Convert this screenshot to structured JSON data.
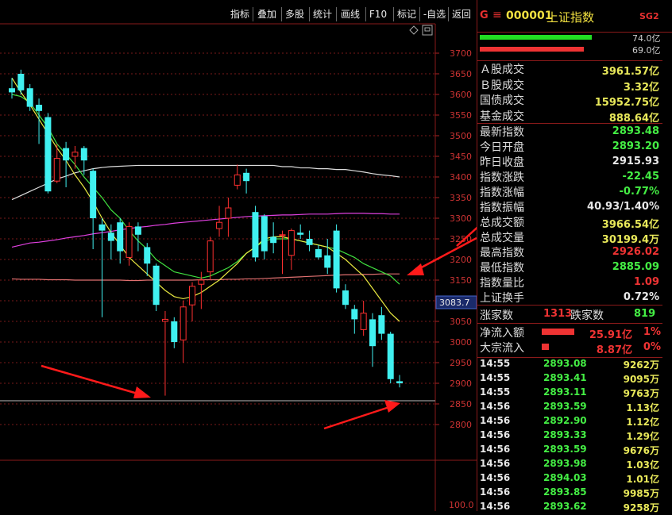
{
  "toolbar": {
    "buttons": [
      "指标",
      "叠加",
      "多股",
      "统计",
      "画线",
      "F10",
      "标记",
      "-自选",
      "返回"
    ]
  },
  "header": {
    "g": "G",
    "menu_glyph": "≡",
    "code": "000001",
    "name": "上证指数",
    "badge": "SG2"
  },
  "bars": [
    {
      "color": "#22dd22",
      "fill": 0.74,
      "label": "74.0亿"
    },
    {
      "color": "#ee3333",
      "fill": 0.69,
      "label": "69.0亿"
    }
  ],
  "turnover": [
    {
      "label": "Ａ股成交",
      "value": "3961.57亿",
      "color": "#e8e85a"
    },
    {
      "label": "Ｂ股成交",
      "value": "3.32亿",
      "color": "#e8e85a"
    },
    {
      "label": "国债成交",
      "value": "15952.75亿",
      "color": "#e8e85a"
    },
    {
      "label": "基金成交",
      "value": "888.64亿",
      "color": "#e8e85a"
    }
  ],
  "stats": [
    {
      "label": "最新指数",
      "value": "2893.48",
      "color": "#44ee44"
    },
    {
      "label": "今日开盘",
      "value": "2893.20",
      "color": "#44ee44"
    },
    {
      "label": "昨日收盘",
      "value": "2915.93",
      "color": "#e8e8e8"
    },
    {
      "label": "指数涨跌",
      "value": "-22.45",
      "color": "#44ee44"
    },
    {
      "label": "指数涨幅",
      "value": "-0.77%",
      "color": "#44ee44"
    },
    {
      "label": "指数振幅",
      "value": "40.93/1.40%",
      "color": "#e8e8e8"
    },
    {
      "label": "总成交额",
      "value": "3966.54亿",
      "color": "#e8e85a"
    },
    {
      "label": "总成交量",
      "value": "30199.4万",
      "color": "#e8e85a"
    },
    {
      "label": "最高指数",
      "value": "2926.02",
      "color": "#ee3333"
    },
    {
      "label": "最低指数",
      "value": "2885.09",
      "color": "#44ee44"
    },
    {
      "label": "指数量比",
      "value": "1.09",
      "color": "#ee3333"
    },
    {
      "label": "上证换手",
      "value": "0.72%",
      "color": "#e8e8e8"
    }
  ],
  "breadth": {
    "up_label": "涨家数",
    "up_value": "1313",
    "down_label": "跌家数",
    "down_value": "819"
  },
  "flows": [
    {
      "label": "净流入额",
      "value": "25.91亿",
      "pct": "1%",
      "bar": 0.9
    },
    {
      "label": "大宗流入",
      "value": "8.87亿",
      "pct": "0%",
      "bar": 0.2
    }
  ],
  "ticks": [
    {
      "time": "14:55",
      "price": "2893.08",
      "vol": "9262万"
    },
    {
      "time": "14:55",
      "price": "2893.41",
      "vol": "9095万"
    },
    {
      "time": "14:55",
      "price": "2893.11",
      "vol": "9763万"
    },
    {
      "time": "14:56",
      "price": "2893.59",
      "vol": "1.13亿"
    },
    {
      "time": "14:56",
      "price": "2892.90",
      "vol": "1.12亿"
    },
    {
      "time": "14:56",
      "price": "2893.33",
      "vol": "1.29亿"
    },
    {
      "time": "14:56",
      "price": "2893.59",
      "vol": "9676万"
    },
    {
      "time": "14:56",
      "price": "2893.98",
      "vol": "1.03亿"
    },
    {
      "time": "14:56",
      "price": "2894.03",
      "vol": "1.01亿"
    },
    {
      "time": "14:56",
      "price": "2893.85",
      "vol": "9985万"
    },
    {
      "time": "14:56",
      "price": "2893.62",
      "vol": "9258万"
    }
  ],
  "chart_data": {
    "type": "candlestick",
    "ylim": [
      2810,
      3730
    ],
    "yticks": [
      2800,
      2850,
      2900,
      2950,
      3000,
      3050,
      3100,
      3150,
      3200,
      3250,
      3300,
      3350,
      3400,
      3450,
      3500,
      3550,
      3600,
      3650,
      3700
    ],
    "current_price_label": "3083.7",
    "current_price": 3083.7,
    "lower_panel_label": "100.0",
    "support_level": 2870,
    "candles": [
      [
        3615,
        3605,
        3640,
        3590
      ],
      [
        3650,
        3610,
        3660,
        3600
      ],
      [
        3615,
        3570,
        3625,
        3560
      ],
      [
        3575,
        3560,
        3590,
        3480
      ],
      [
        3545,
        3365,
        3555,
        3360
      ],
      [
        3390,
        3445,
        3480,
        3385
      ],
      [
        3470,
        3440,
        3485,
        3375
      ],
      [
        3450,
        3460,
        3475,
        3420
      ],
      [
        3470,
        3440,
        3475,
        3405
      ],
      [
        3415,
        3300,
        3420,
        3225
      ],
      [
        3285,
        3270,
        3300,
        3060
      ],
      [
        3265,
        3245,
        3285,
        3200
      ],
      [
        3290,
        3220,
        3300,
        3190
      ],
      [
        3205,
        3280,
        3290,
        3185
      ],
      [
        3280,
        3260,
        3290,
        3220
      ],
      [
        3230,
        3190,
        3240,
        3160
      ],
      [
        3185,
        3090,
        3190,
        3075
      ],
      [
        3050,
        3055,
        3075,
        2870
      ],
      [
        3050,
        3000,
        3060,
        2985
      ],
      [
        3005,
        3085,
        3100,
        2950
      ],
      [
        3090,
        3135,
        3145,
        3050
      ],
      [
        3140,
        3150,
        3170,
        3080
      ],
      [
        3170,
        3245,
        3255,
        3150
      ],
      [
        3275,
        3290,
        3330,
        3255
      ],
      [
        3300,
        3325,
        3350,
        3255
      ],
      [
        3380,
        3405,
        3430,
        3370
      ],
      [
        3410,
        3390,
        3420,
        3360
      ],
      [
        3315,
        3205,
        3330,
        3195
      ],
      [
        3305,
        3220,
        3310,
        3200
      ],
      [
        3255,
        3240,
        3290,
        3215
      ],
      [
        3260,
        3260,
        3270,
        3165
      ],
      [
        3210,
        3270,
        3275,
        3175
      ],
      [
        3265,
        3260,
        3285,
        3250
      ],
      [
        3250,
        3235,
        3270,
        3220
      ],
      [
        3225,
        3205,
        3235,
        3200
      ],
      [
        3210,
        3180,
        3250,
        3165
      ],
      [
        3270,
        3130,
        3285,
        3120
      ],
      [
        3125,
        3090,
        3140,
        3080
      ],
      [
        3080,
        3055,
        3090,
        3020
      ],
      [
        3030,
        3070,
        3100,
        3015
      ],
      [
        3055,
        2990,
        3070,
        2940
      ],
      [
        3065,
        3020,
        3085,
        3005
      ],
      [
        3020,
        2910,
        3025,
        2900
      ],
      [
        2905,
        2900,
        2920,
        2890
      ]
    ],
    "ma_yellow": [
      3640,
      3605,
      3575,
      3540,
      3505,
      3470,
      3440,
      3405,
      3375,
      3340,
      3300,
      3265,
      3235,
      3205,
      3185,
      3165,
      3145,
      3125,
      3110,
      3105,
      3110,
      3120,
      3135,
      3150,
      3170,
      3190,
      3215,
      3230,
      3250,
      3255,
      3255,
      3250,
      3245,
      3240,
      3235,
      3230,
      3215,
      3200,
      3180,
      3160,
      3130,
      3100,
      3070,
      3050
    ],
    "ma_green": [
      3600,
      3595,
      3580,
      3550,
      3520,
      3480,
      3455,
      3430,
      3400,
      3375,
      3350,
      3320,
      3300,
      3270,
      3245,
      3225,
      3200,
      3185,
      3170,
      3165,
      3160,
      3155,
      3160,
      3170,
      3180,
      3195,
      3215,
      3230,
      3245,
      3250,
      3250,
      3250,
      3245,
      3240,
      3235,
      3230,
      3225,
      3215,
      3205,
      3190,
      3180,
      3170,
      3160,
      3140
    ],
    "ma_white": [
      3345,
      3355,
      3365,
      3375,
      3385,
      3395,
      3402,
      3410,
      3415,
      3420,
      3423,
      3425,
      3426,
      3427,
      3428,
      3428,
      3428,
      3428,
      3428,
      3428,
      3428,
      3428,
      3428,
      3428,
      3428,
      3428,
      3428,
      3428,
      3428,
      3428,
      3425,
      3425,
      3422,
      3422,
      3420,
      3420,
      3418,
      3418,
      3415,
      3412,
      3408,
      3405,
      3403,
      3400
    ],
    "ma_magenta": [
      3230,
      3235,
      3240,
      3242,
      3245,
      3248,
      3252,
      3255,
      3258,
      3262,
      3265,
      3268,
      3272,
      3275,
      3278,
      3280,
      3283,
      3285,
      3288,
      3290,
      3292,
      3294,
      3296,
      3298,
      3300,
      3302,
      3304,
      3305,
      3306,
      3307,
      3308,
      3308,
      3309,
      3310,
      3310,
      3310,
      3311,
      3312,
      3312,
      3312,
      3311,
      3311,
      3310,
      3310
    ],
    "ma_pink": [
      3153,
      3152,
      3152,
      3152,
      3151,
      3151,
      3151,
      3150,
      3150,
      3150,
      3150,
      3150,
      3150,
      3149,
      3149,
      3150,
      3150,
      3150,
      3150,
      3150,
      3150,
      3151,
      3151,
      3151,
      3152,
      3152,
      3153,
      3153,
      3154,
      3155,
      3156,
      3157,
      3158,
      3159,
      3160,
      3161,
      3162,
      3163,
      3163,
      3164,
      3164,
      3165,
      3165,
      3165
    ]
  }
}
